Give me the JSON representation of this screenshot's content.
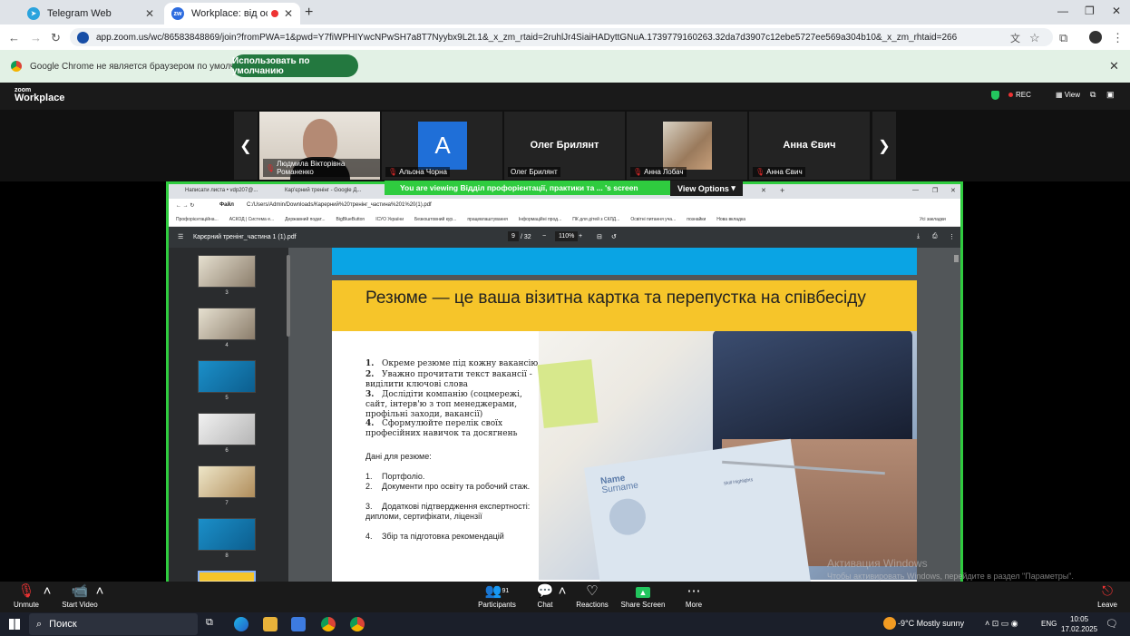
{
  "browser": {
    "tabs": [
      {
        "title": "Telegram Web"
      },
      {
        "title": "Workplace: від освіти до к..."
      }
    ],
    "url": "app.zoom.us/wc/86583848869/join?fromPWA=1&pwd=Y7fiWPHIYwcNPwSH7a8T7Nyybx9L2t.1&_x_zm_rtaid=2ruhlJr4SiaiHADyttGNuA.1739779160263.32da7d3907c12ebe5727ee569a304b10&_x_zm_rhtaid=266",
    "info_text": "Google Chrome не является браузером по умолчанию.",
    "info_button": "Использовать по умолчанию"
  },
  "zoom": {
    "logo_top": "zoom",
    "logo_bottom": "Workplace",
    "rec": "REC",
    "view": "View",
    "participants_tiles": [
      {
        "name": "Людмила Вікторівна Романенко"
      },
      {
        "name": "Альона Чорна",
        "initial": "A"
      },
      {
        "name": "Олег Брилянт"
      },
      {
        "name": "Анна Лобач"
      },
      {
        "name": "Анна Євич"
      }
    ],
    "viewing_text": "You are viewing  Відділ профорієнтації, практики та ... 's screen",
    "view_options": "View Options",
    "toolbar": {
      "unmute": "Unmute",
      "start_video": "Start Video",
      "participants": "Participants",
      "participants_count": "91",
      "chat": "Chat",
      "reactions": "Reactions",
      "share_screen": "Share Screen",
      "more": "More",
      "leave": "Leave"
    }
  },
  "shared": {
    "inner_tabs": [
      "Написати листа • vdp207@...",
      "Кар'єрний тренінг - Google Д...",
      "Google Docs"
    ],
    "inner_path": "C:/Users/Admin/Downloads/Карерний%20тренінг_частина%201%20(1).pdf",
    "inner_path_label": "Файл",
    "bookmarks": [
      "Профорієнтаційна...",
      "АСКОД | Система е...",
      "Державний подат...",
      "BigBlueButton",
      "ІСУО України",
      "Безкоштовний кур...",
      "працевлаштування",
      "Інформаційні прод...",
      "ПК для дітей з СКЛД...",
      "Освітні питання уча...",
      "познайки",
      "Нова вкладка",
      "Усі закладки"
    ],
    "pdf_filename": "Карєрний тренінг_частина 1 (1).pdf",
    "page_current": "9",
    "page_total": "/ 32",
    "zoom_level": "110%",
    "thumb_numbers": [
      "3",
      "4",
      "5",
      "6",
      "7",
      "8"
    ],
    "slide_title": "Резюме — це ваша візитна картка та перепустка на співбесіду",
    "tips": [
      {
        "n": "1.",
        "t": "Окреме резюме під кожну вакансію"
      },
      {
        "n": "2.",
        "t": "Уважно прочитати текст вакансії - виділити ключові слова"
      },
      {
        "n": "3.",
        "t": "Дослідіти компанію (соцмережі, сайт, інтерв'ю з топ менеджерами, профільні заходи, вакансії)"
      },
      {
        "n": "4.",
        "t": "Сформулюйте перелік своїх професійних навичок та досягнень"
      }
    ],
    "data_heading": "Дані для резюме:",
    "data_items": [
      {
        "n": "1.",
        "t": "Портфоліо."
      },
      {
        "n": "2.",
        "t": "Документи про освіту та робочий стаж."
      },
      {
        "n": "3.",
        "t": "Додаткові підтвердження експертності: дипломи, сертифікати, ліцензії"
      },
      {
        "n": "4.",
        "t": "Збір та підготовка рекомендацій"
      }
    ],
    "resume_name": "Name",
    "resume_surname": "Surname",
    "resume_skill": "Skill Highlights"
  },
  "watermark": {
    "line1": "Активация Windows",
    "line2": "Чтобы активировать Windows, перейдите в раздел \"Параметры\"."
  },
  "taskbar": {
    "search": "Поиск",
    "weather": "-9°C  Mostly sunny",
    "lang": "ENG",
    "time": "10:05",
    "date": "17.02.2025"
  }
}
